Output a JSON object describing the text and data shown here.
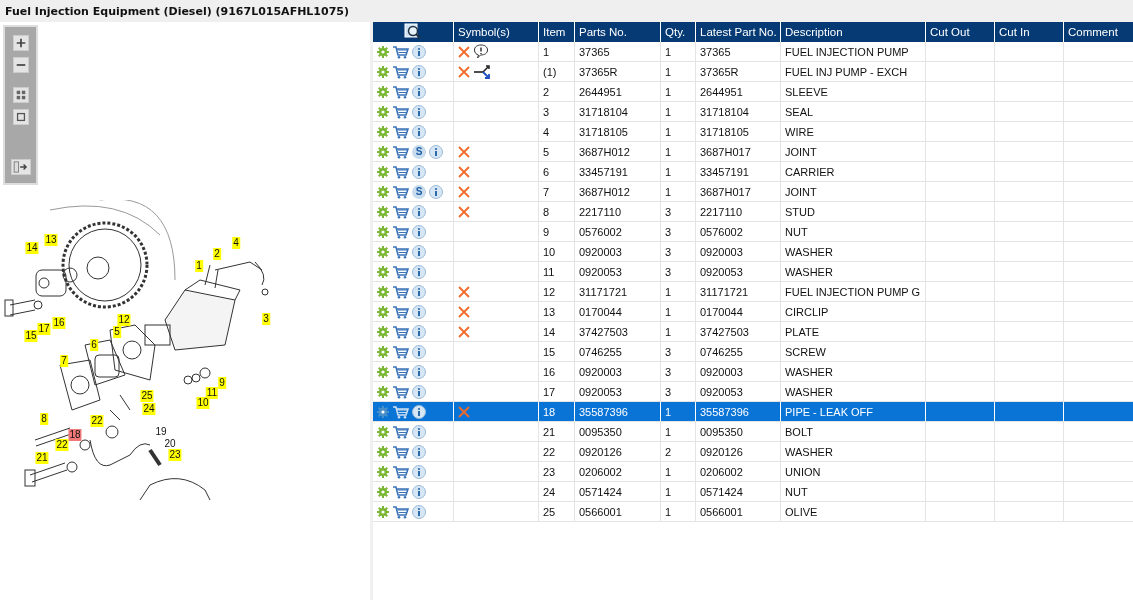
{
  "title": "Fuel Injection Equipment (Diesel) (9167L015AFHL1075)",
  "callouts": [
    {
      "label": "13",
      "boxed": true,
      "selected": false
    },
    {
      "label": "4",
      "boxed": true,
      "selected": false
    },
    {
      "label": "14",
      "boxed": true,
      "selected": false
    },
    {
      "label": "2",
      "boxed": true,
      "selected": false
    },
    {
      "label": "1",
      "boxed": true,
      "selected": false
    },
    {
      "label": "12",
      "boxed": true,
      "selected": false
    },
    {
      "label": "3",
      "boxed": true,
      "selected": false
    },
    {
      "label": "16",
      "boxed": true,
      "selected": false
    },
    {
      "label": "17",
      "boxed": true,
      "selected": false
    },
    {
      "label": "5",
      "boxed": true,
      "selected": false
    },
    {
      "label": "15",
      "boxed": true,
      "selected": false
    },
    {
      "label": "6",
      "boxed": true,
      "selected": false
    },
    {
      "label": "7",
      "boxed": true,
      "selected": false
    },
    {
      "label": "9",
      "boxed": true,
      "selected": false
    },
    {
      "label": "11",
      "boxed": true,
      "selected": false
    },
    {
      "label": "25",
      "boxed": true,
      "selected": false
    },
    {
      "label": "10",
      "boxed": true,
      "selected": false
    },
    {
      "label": "24",
      "boxed": true,
      "selected": false
    },
    {
      "label": "8",
      "boxed": true,
      "selected": false
    },
    {
      "label": "22",
      "boxed": true,
      "selected": false
    },
    {
      "label": "19",
      "boxed": false,
      "selected": false
    },
    {
      "label": "18",
      "boxed": true,
      "selected": true
    },
    {
      "label": "20",
      "boxed": false,
      "selected": false
    },
    {
      "label": "22",
      "boxed": true,
      "selected": false
    },
    {
      "label": "23",
      "boxed": true,
      "selected": false
    },
    {
      "label": "21",
      "boxed": true,
      "selected": false
    }
  ],
  "table": {
    "columns": [
      "Symbol(s)",
      "Item",
      "Parts No.",
      "Qty.",
      "Latest Part No.",
      "Description",
      "Cut Out",
      "Cut In",
      "Comment"
    ],
    "rows": [
      {
        "symbols": [
          {
            "kind": "cross"
          },
          {
            "kind": "note"
          }
        ],
        "item": "1",
        "part": "37365",
        "qty": "1",
        "latest": "37365",
        "description": "FUEL INJECTION PUMP",
        "selected": false
      },
      {
        "symbols": [
          {
            "kind": "cross"
          },
          {
            "kind": "exchange"
          }
        ],
        "item": "(1)",
        "part": "37365R",
        "qty": "1",
        "latest": "37365R",
        "description": "FUEL INJ PUMP - EXCH",
        "selected": false
      },
      {
        "item": "2",
        "part": "2644951",
        "qty": "1",
        "latest": "2644951",
        "description": "SLEEVE",
        "selected": false
      },
      {
        "item": "3",
        "part": "31718104",
        "qty": "1",
        "latest": "31718104",
        "description": "SEAL",
        "selected": false
      },
      {
        "item": "4",
        "part": "31718105",
        "qty": "1",
        "latest": "31718105",
        "description": "WIRE",
        "selected": false
      },
      {
        "badge": "S",
        "symbols": [
          {
            "kind": "cross"
          }
        ],
        "item": "5",
        "part": "3687H012",
        "qty": "1",
        "latest": "3687H017",
        "description": "JOINT",
        "selected": false
      },
      {
        "symbols": [
          {
            "kind": "cross"
          }
        ],
        "item": "6",
        "part": "33457191",
        "qty": "1",
        "latest": "33457191",
        "description": "CARRIER",
        "selected": false
      },
      {
        "badge": "S",
        "symbols": [
          {
            "kind": "cross"
          }
        ],
        "item": "7",
        "part": "3687H012",
        "qty": "1",
        "latest": "3687H017",
        "description": "JOINT",
        "selected": false
      },
      {
        "symbols": [
          {
            "kind": "cross"
          }
        ],
        "item": "8",
        "part": "2217110",
        "qty": "3",
        "latest": "2217110",
        "description": "STUD",
        "selected": false
      },
      {
        "item": "9",
        "part": "0576002",
        "qty": "3",
        "latest": "0576002",
        "description": "NUT",
        "selected": false
      },
      {
        "item": "10",
        "part": "0920003",
        "qty": "3",
        "latest": "0920003",
        "description": "WASHER",
        "selected": false
      },
      {
        "item": "11",
        "part": "0920053",
        "qty": "3",
        "latest": "0920053",
        "description": "WASHER",
        "selected": false
      },
      {
        "symbols": [
          {
            "kind": "cross"
          }
        ],
        "item": "12",
        "part": "31171721",
        "qty": "1",
        "latest": "31171721",
        "description": "FUEL INJECTION PUMP G",
        "selected": false
      },
      {
        "symbols": [
          {
            "kind": "cross"
          }
        ],
        "item": "13",
        "part": "0170044",
        "qty": "1",
        "latest": "0170044",
        "description": "CIRCLIP",
        "selected": false
      },
      {
        "symbols": [
          {
            "kind": "cross"
          }
        ],
        "item": "14",
        "part": "37427503",
        "qty": "1",
        "latest": "37427503",
        "description": "PLATE",
        "selected": false
      },
      {
        "item": "15",
        "part": "0746255",
        "qty": "3",
        "latest": "0746255",
        "description": "SCREW",
        "selected": false
      },
      {
        "item": "16",
        "part": "0920003",
        "qty": "3",
        "latest": "0920003",
        "description": "WASHER",
        "selected": false
      },
      {
        "item": "17",
        "part": "0920053",
        "qty": "3",
        "latest": "0920053",
        "description": "WASHER",
        "selected": false
      },
      {
        "symbols": [
          {
            "kind": "cross"
          }
        ],
        "item": "18",
        "part": "35587396",
        "qty": "1",
        "latest": "35587396",
        "description": "PIPE - LEAK OFF",
        "selected": true
      },
      {
        "item": "21",
        "part": "0095350",
        "qty": "1",
        "latest": "0095350",
        "description": "BOLT",
        "selected": false
      },
      {
        "item": "22",
        "part": "0920126",
        "qty": "2",
        "latest": "0920126",
        "description": "WASHER",
        "selected": false
      },
      {
        "item": "23",
        "part": "0206002",
        "qty": "1",
        "latest": "0206002",
        "description": "UNION",
        "selected": false
      },
      {
        "item": "24",
        "part": "0571424",
        "qty": "1",
        "latest": "0571424",
        "description": "NUT",
        "selected": false
      },
      {
        "item": "25",
        "part": "0566001",
        "qty": "1",
        "latest": "0566001",
        "description": "OLIVE",
        "selected": false
      }
    ]
  }
}
